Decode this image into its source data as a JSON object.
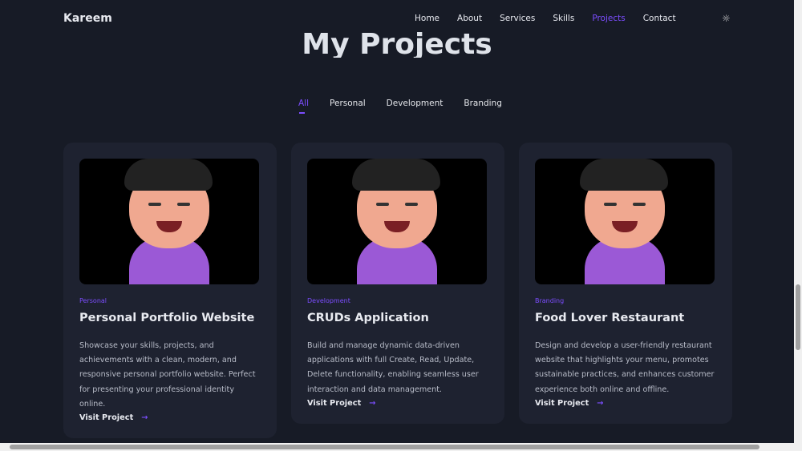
{
  "nav": {
    "logo": "Kareem",
    "items": [
      "Home",
      "About",
      "Services",
      "Skills",
      "Projects",
      "Contact"
    ],
    "active": "Projects",
    "theme_icon": "sun-icon"
  },
  "section_title": "My Projects",
  "filters": [
    "All",
    "Personal",
    "Development",
    "Branding"
  ],
  "projects": [
    {
      "category": "Personal",
      "title": "Personal Portfolio Website",
      "description": "Showcase your skills, projects, and achievements with a clean, modern, and responsive personal portfolio website. Perfect for presenting your professional identity online.",
      "link": "Visit Project"
    },
    {
      "category": "Development",
      "title": "CRUDs Application",
      "description": "Build and manage dynamic data-driven applications with full Create, Read, Update, Delete functionality, enabling seamless user interaction and data management.",
      "link": "Visit Project"
    },
    {
      "category": "Branding",
      "title": "Food Lover Restaurant",
      "description": "Design and develop a user-friendly restaurant website that highlights your menu, promotes sustainable practices, and enhances customer experience both online and offline.",
      "link": "Visit Project"
    }
  ],
  "colors": {
    "accent": "#7c4dff",
    "background": "#171b26",
    "card": "#1e2230"
  }
}
